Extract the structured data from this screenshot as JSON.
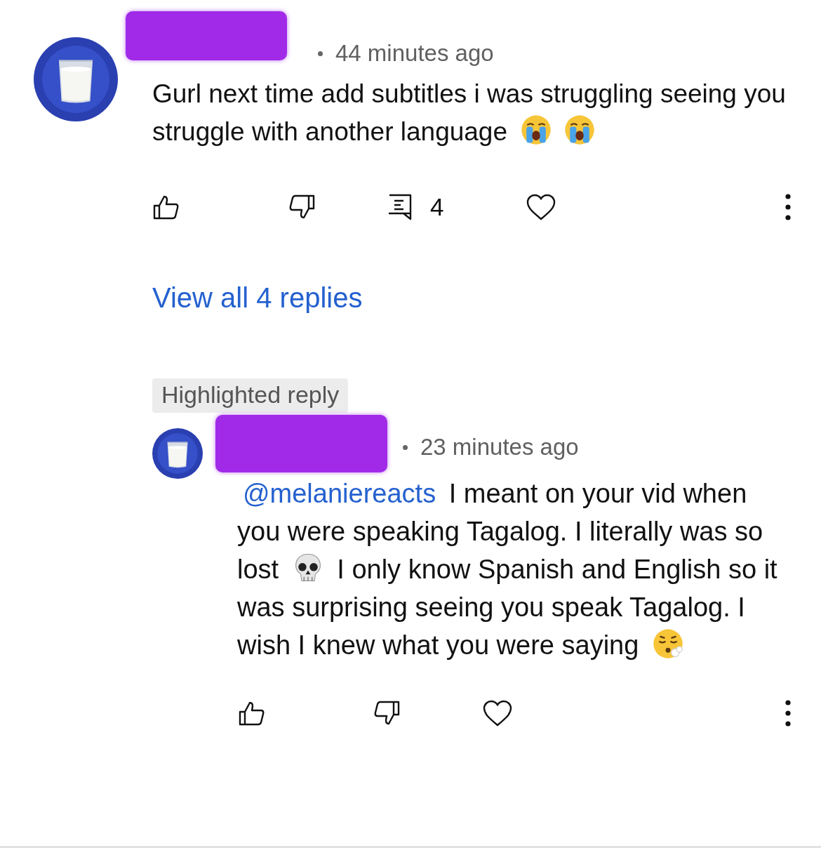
{
  "comment": {
    "time": "44 minutes ago",
    "body": [
      {
        "kind": "text",
        "text": "Gurl next time add subtitles i was struggling seeing you struggle with another language "
      },
      {
        "kind": "crying_face"
      },
      {
        "kind": "crying_face"
      }
    ],
    "reply_count": "4",
    "view_replies": "View all 4 replies"
  },
  "highlight_label": "Highlighted reply",
  "reply": {
    "time": "23 minutes ago",
    "body": [
      {
        "kind": "mention",
        "text": "@melaniereacts"
      },
      {
        "kind": "text",
        "text": " I meant on your vid when you were speaking Tagalog. I literally was so lost "
      },
      {
        "kind": "skull"
      },
      {
        "kind": "text",
        "text": " I only know Spanish and English so it was surprising seeing you speak Tagalog. I wish I knew what you were saying "
      },
      {
        "kind": "sighing_face"
      }
    ]
  }
}
